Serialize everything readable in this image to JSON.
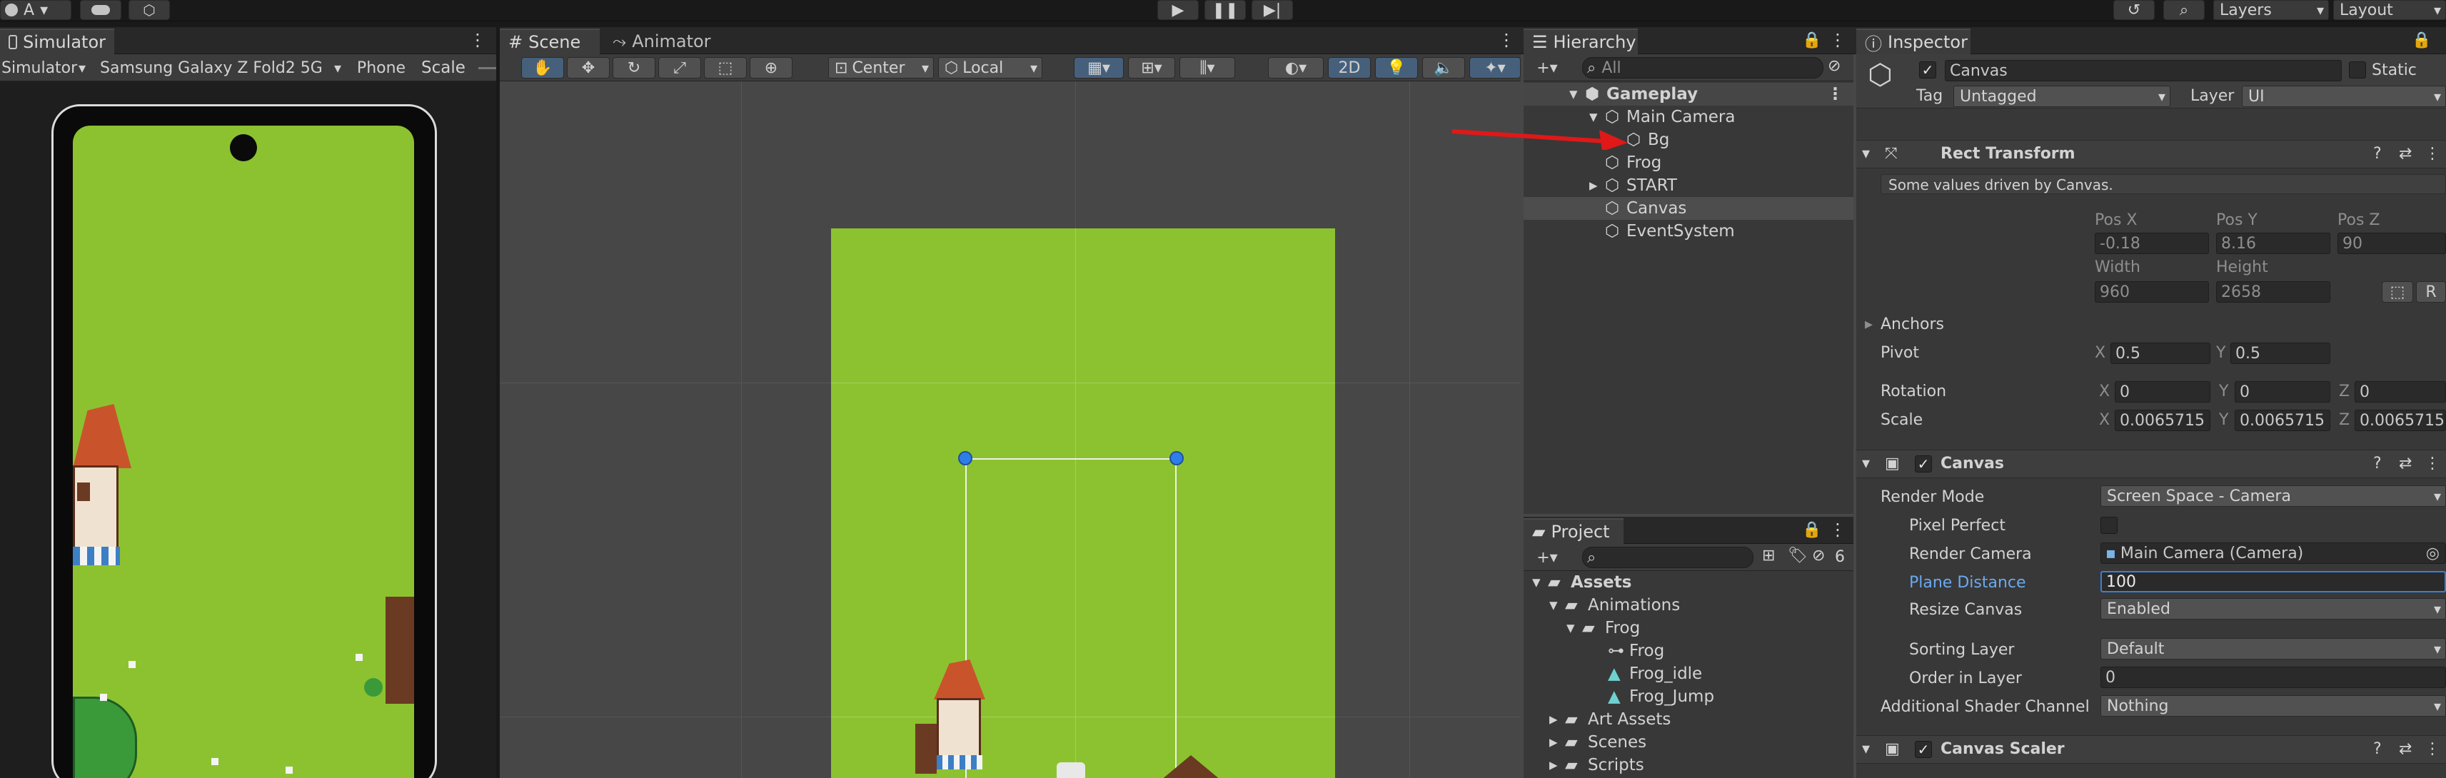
{
  "top_bar": {
    "account_label": "A",
    "layers_label": "Layers",
    "layout_label": "Layout"
  },
  "simulator": {
    "tab": "Simulator",
    "mode": "Simulator",
    "device": "Samsung Galaxy Z Fold2 5G",
    "form_factor": "Phone",
    "scale_label": "Scale"
  },
  "scene": {
    "tab_scene": "Scene",
    "tab_animator": "Animator",
    "pivot_mode": "Center",
    "pivot_rotation": "Local",
    "mode_2d": "2D"
  },
  "hierarchy": {
    "tab": "Hierarchy",
    "search_placeholder": "All",
    "items": [
      {
        "label": "Gameplay"
      },
      {
        "label": "Main Camera"
      },
      {
        "label": "Bg"
      },
      {
        "label": "Frog"
      },
      {
        "label": "START"
      },
      {
        "label": "Canvas"
      },
      {
        "label": "EventSystem"
      }
    ]
  },
  "project": {
    "tab": "Project",
    "hidden_count": "6",
    "items": [
      {
        "label": "Assets"
      },
      {
        "label": "Animations"
      },
      {
        "label": "Frog"
      },
      {
        "label": "Frog"
      },
      {
        "label": "Frog_idle"
      },
      {
        "label": "Frog_Jump"
      },
      {
        "label": "Art Assets"
      },
      {
        "label": "Scenes"
      },
      {
        "label": "Scripts"
      }
    ]
  },
  "inspector": {
    "tab": "Inspector",
    "object_name": "Canvas",
    "static_label": "Static",
    "tag_label": "Tag",
    "tag_value": "Untagged",
    "layer_label": "Layer",
    "layer_value": "UI",
    "rect_transform": {
      "title": "Rect Transform",
      "driven_note": "Some values driven by Canvas.",
      "pos_x_label": "Pos X",
      "pos_x": "-0.18",
      "pos_y_label": "Pos Y",
      "pos_y": "8.16",
      "pos_z_label": "Pos Z",
      "pos_z": "90",
      "width_label": "Width",
      "width": "960",
      "height_label": "Height",
      "height": "2658",
      "r_button": "R",
      "anchors_label": "Anchors",
      "pivot_label": "Pivot",
      "pivot_x": "0.5",
      "pivot_y": "0.5",
      "rotation_label": "Rotation",
      "rot_x": "0",
      "rot_y": "0",
      "rot_z": "0",
      "scale_label": "Scale",
      "scale_x": "0.0065715",
      "scale_y": "0.0065715",
      "scale_z": "0.0065715",
      "x": "X",
      "y": "Y",
      "z": "Z"
    },
    "canvas": {
      "title": "Canvas",
      "render_mode_label": "Render Mode",
      "render_mode": "Screen Space - Camera",
      "pixel_perfect_label": "Pixel Perfect",
      "render_camera_label": "Render Camera",
      "render_camera": "Main Camera (Camera)",
      "plane_distance_label": "Plane Distance",
      "plane_distance": "100",
      "resize_canvas_label": "Resize Canvas",
      "resize_canvas": "Enabled",
      "sorting_layer_label": "Sorting Layer",
      "sorting_layer": "Default",
      "order_in_layer_label": "Order in Layer",
      "order_in_layer": "0",
      "shader_channel_label": "Additional Shader Channel",
      "shader_channel": "Nothing"
    },
    "canvas_scaler": {
      "title": "Canvas Scaler"
    }
  },
  "colors": {
    "grass": "#8cc230",
    "selection": "#2c5d87",
    "accent_blue": "#4c8fd6",
    "arrow_red": "#e01818"
  }
}
